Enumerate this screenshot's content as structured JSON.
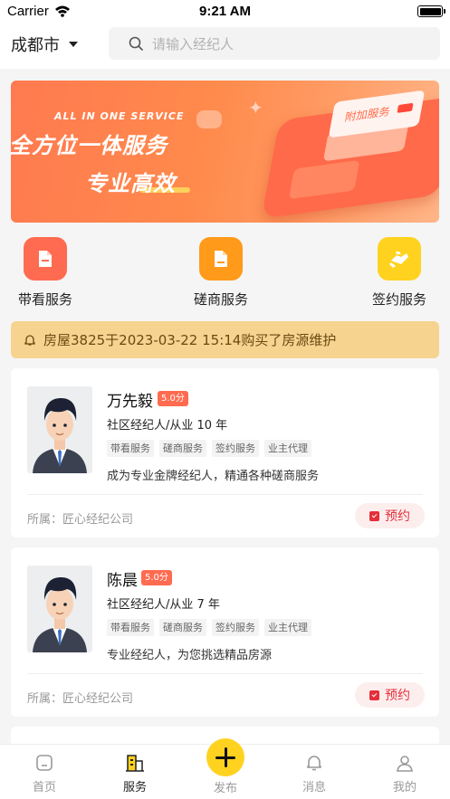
{
  "status_bar": {
    "carrier": "Carrier",
    "time": "9:21 AM"
  },
  "header": {
    "city": "成都市",
    "search_placeholder": "请输入经纪人"
  },
  "banner": {
    "subtitle": "ALL IN ONE SERVICE",
    "title_line1": "全方位一体服务",
    "title_line2": "专业高效",
    "card_label": "附加服务"
  },
  "services": [
    {
      "label": "带看服务",
      "icon": "document-icon",
      "color": "#ff6b50"
    },
    {
      "label": "磋商服务",
      "icon": "file-icon",
      "color": "#ff9a1a"
    },
    {
      "label": "签约服务",
      "icon": "handshake-icon",
      "color": "#ffd21f"
    }
  ],
  "notice": {
    "text": "房屋3825于2023-03-22 15:14购买了房源维护"
  },
  "agents": [
    {
      "name": "万先毅",
      "score": "5.0分",
      "experience": "社区经纪人/从业 10 年",
      "tags": [
        "带看服务",
        "磋商服务",
        "签约服务",
        "业主代理"
      ],
      "description": "成为专业金牌经纪人，精通各种磋商服务",
      "company": "所属：匠心经纪公司",
      "book_label": "预约"
    },
    {
      "name": "陈晨",
      "score": "5.0分",
      "experience": "社区经纪人/从业 7 年",
      "tags": [
        "带看服务",
        "磋商服务",
        "签约服务",
        "业主代理"
      ],
      "description": "专业经纪人，为您挑选精品房源",
      "company": "所属：匠心经纪公司",
      "book_label": "预约"
    }
  ],
  "tabbar": {
    "tabs": [
      {
        "label": "首页",
        "icon": "home-icon",
        "active": false
      },
      {
        "label": "服务",
        "icon": "building-icon",
        "active": true
      },
      {
        "label": "发布",
        "icon": "plus-icon",
        "active": false
      },
      {
        "label": "消息",
        "icon": "bell-icon",
        "active": false
      },
      {
        "label": "我的",
        "icon": "user-icon",
        "active": false
      }
    ]
  },
  "colors": {
    "accent": "#ff6b50",
    "notice_bg": "#f6d38f",
    "book_red": "#e5303b",
    "fab_yellow": "#ffd21f"
  }
}
